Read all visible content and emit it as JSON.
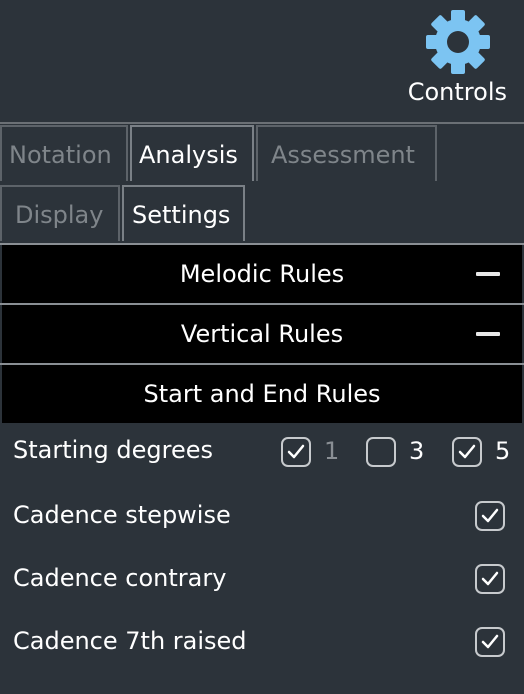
{
  "header": {
    "controls_label": "Controls",
    "icon": "gear-icon"
  },
  "tabs_main": [
    {
      "label": "Notation",
      "active": false
    },
    {
      "label": "Analysis",
      "active": true
    },
    {
      "label": "Assessment",
      "active": false
    }
  ],
  "tabs_sub": [
    {
      "label": "Display",
      "active": false
    },
    {
      "label": "Settings",
      "active": true
    }
  ],
  "sections": [
    {
      "label": "Melodic Rules",
      "collapse_icon": "minus-icon"
    },
    {
      "label": "Vertical Rules",
      "collapse_icon": "minus-icon"
    },
    {
      "label": "Start and End Rules"
    }
  ],
  "starting_degrees": {
    "label": "Starting degrees",
    "options": [
      {
        "value": "1",
        "checked": true,
        "disabled": true
      },
      {
        "value": "3",
        "checked": false
      },
      {
        "value": "5",
        "checked": true
      }
    ]
  },
  "rules": [
    {
      "label": "Cadence stepwise",
      "checked": true
    },
    {
      "label": "Cadence contrary",
      "checked": true
    },
    {
      "label": "Cadence 7th raised",
      "checked": true
    }
  ]
}
